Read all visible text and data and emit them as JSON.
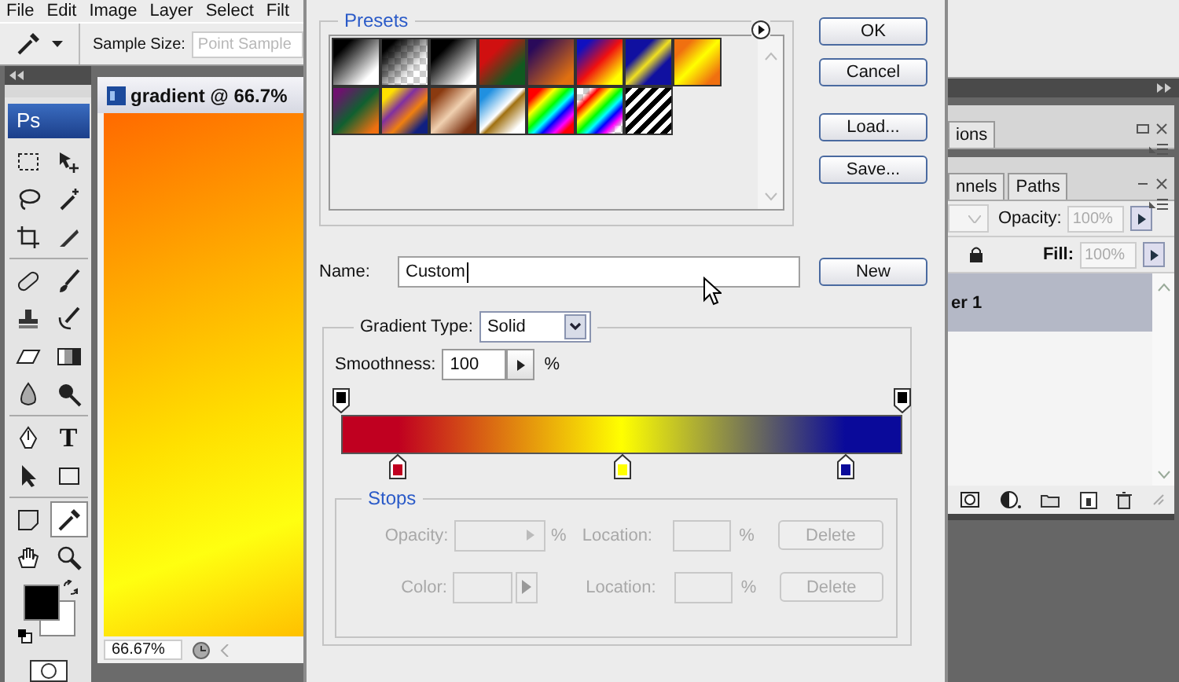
{
  "menu_bar": [
    "File",
    "Edit",
    "Image",
    "Layer",
    "Select",
    "Filt"
  ],
  "options_bar": {
    "label": "Sample Size:",
    "value": "Point Sample",
    "disabled": true
  },
  "toolbox": {
    "logo": "Ps",
    "groups": [
      [
        {
          "kind": "marquee",
          "selected": false
        },
        {
          "kind": "move",
          "selected": false
        },
        {
          "kind": "lasso",
          "selected": false
        },
        {
          "kind": "wand",
          "selected": false
        },
        {
          "kind": "crop",
          "selected": false
        },
        {
          "kind": "slice",
          "selected": false
        }
      ],
      [
        {
          "kind": "heal",
          "selected": false
        },
        {
          "kind": "brush",
          "selected": false
        },
        {
          "kind": "stamp",
          "selected": false
        },
        {
          "kind": "history",
          "selected": false
        },
        {
          "kind": "eraser",
          "selected": false
        },
        {
          "kind": "gradient",
          "selected": false
        },
        {
          "kind": "blur",
          "selected": false
        },
        {
          "kind": "burn",
          "selected": false
        }
      ],
      [
        {
          "kind": "pen",
          "selected": false
        },
        {
          "kind": "type",
          "label": "T",
          "selected": false
        },
        {
          "kind": "path-select",
          "selected": false
        },
        {
          "kind": "shape",
          "selected": false
        }
      ],
      [
        {
          "kind": "notes",
          "selected": false
        },
        {
          "kind": "eyedropper",
          "selected": true
        },
        {
          "kind": "hand",
          "selected": false
        },
        {
          "kind": "zoom",
          "selected": false
        }
      ]
    ]
  },
  "document": {
    "title": "gradient @ 66.7%",
    "zoom": "66.67%"
  },
  "dialog": {
    "presets": {
      "title": "Presets",
      "items": [
        {
          "kind": "fg-bg"
        },
        {
          "kind": "fg-transparent"
        },
        {
          "kind": "black-white"
        },
        {
          "kind": "red-green"
        },
        {
          "kind": "violet-orange"
        },
        {
          "kind": "blue-red-yellow"
        },
        {
          "kind": "blue-yellow-blue"
        },
        {
          "kind": "orange-yellow-orange"
        },
        {
          "kind": "violet-green-orange"
        },
        {
          "kind": "yellow-violet-orange-blue"
        },
        {
          "kind": "copper"
        },
        {
          "kind": "chrome"
        },
        {
          "kind": "spectrum"
        },
        {
          "kind": "transparent-rainbow"
        },
        {
          "kind": "transparent-stripes"
        }
      ]
    },
    "buttons": [
      "OK",
      "Cancel",
      "Load...",
      "Save..."
    ],
    "name": {
      "label": "Name:",
      "value": "Custom"
    },
    "new_button": "New",
    "gradient_type": {
      "label": "Gradient Type:",
      "value": "Solid"
    },
    "smoothness": {
      "label": "Smoothness:",
      "value": "100",
      "unit": "%"
    },
    "opacity_stops": [
      {
        "level": 0
      },
      {
        "level": 1
      }
    ],
    "color_stops": [
      {
        "color": "#c00020",
        "level": 0.1
      },
      {
        "color": "#ffff00",
        "level": 0.5
      },
      {
        "color": "#0a0a9a",
        "level": 0.9
      }
    ],
    "stops": {
      "title": "Stops",
      "disabled": true,
      "rows": [
        {
          "kind": "opacity",
          "label": "Opacity:",
          "unit": "%",
          "location_label": "Location:",
          "location_unit": "%",
          "button": "Delete"
        },
        {
          "kind": "color",
          "label": "Color:",
          "location_label": "Location:",
          "location_unit": "%",
          "button": "Delete"
        }
      ]
    }
  },
  "panels": {
    "top_tab": "ions",
    "tabs": [
      {
        "label": "nnels",
        "selected": false
      },
      {
        "label": "Paths",
        "selected": false
      }
    ],
    "opacity": {
      "label": "Opacity:",
      "value": "100%"
    },
    "fill": {
      "label": "Fill:",
      "value": "100%"
    },
    "layers": [
      {
        "name": "er 1",
        "selected": true
      }
    ]
  }
}
